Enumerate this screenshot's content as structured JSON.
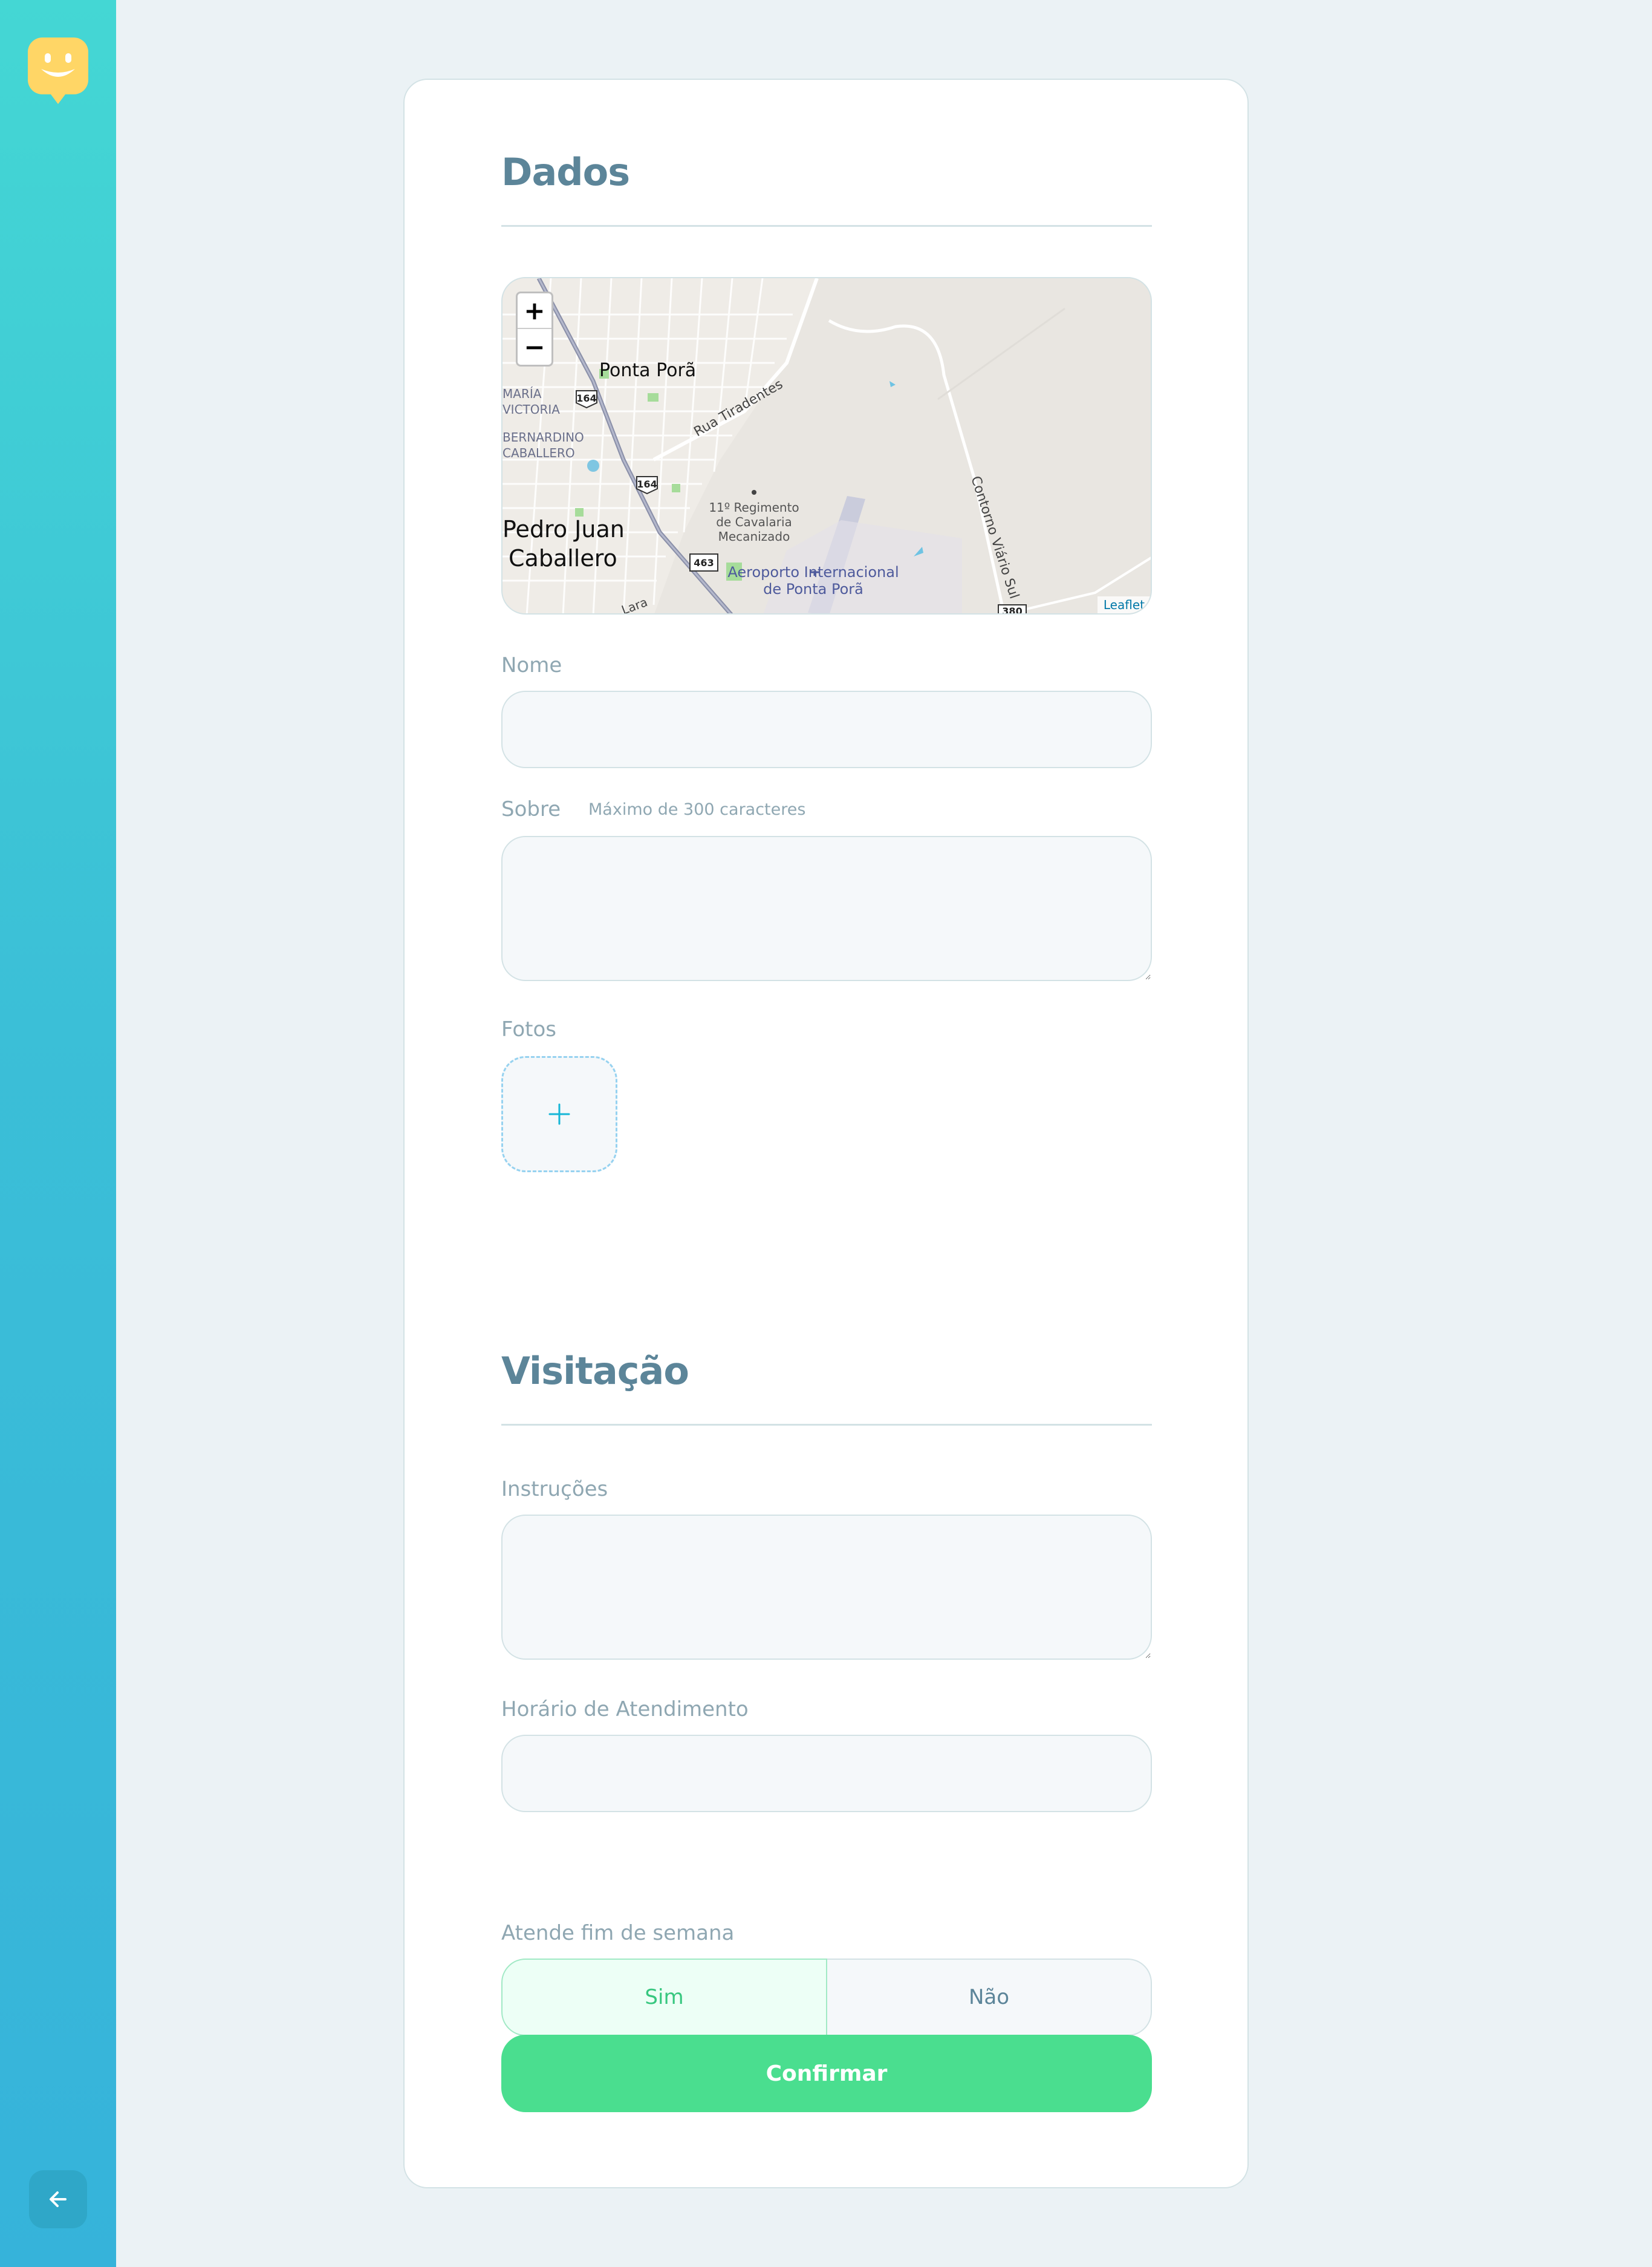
{
  "sidebar": {
    "logo_icon": "happy-face-marker-icon",
    "back_icon": "arrow-left-icon"
  },
  "sections": {
    "dados": {
      "title": "Dados"
    },
    "visitacao": {
      "title": "Visitação"
    }
  },
  "map": {
    "zoom_in": "+",
    "zoom_out": "−",
    "attribution": "Leaflet",
    "labels": {
      "city_main": "Ponta Porã",
      "city_other_1": "Pedro Juan",
      "city_other_2": "Caballero",
      "district_1a": "MARÍA",
      "district_1b": "VICTORIA",
      "district_2a": "BERNARDINO",
      "district_2b": "CABALLERO",
      "street_1": "Rua Tiradentes",
      "street_2": "Contorno Viário Sul",
      "street_3": "Lara",
      "poi_1a": "11º Regimento",
      "poi_1b": "de Cavalaria",
      "poi_1c": "Mecanizado",
      "airport_1": "Aeroporto Internacional",
      "airport_2": "de Ponta Porã",
      "route_164": "164",
      "route_463": "463",
      "route_380": "380"
    }
  },
  "fields": {
    "nome": {
      "label": "Nome",
      "value": ""
    },
    "sobre": {
      "label": "Sobre",
      "hint": "Máximo de 300 caracteres",
      "value": ""
    },
    "fotos": {
      "label": "Fotos"
    },
    "instrucoes": {
      "label": "Instruções",
      "value": ""
    },
    "horario": {
      "label": "Horário de Atendimento",
      "value": ""
    },
    "fim_de_semana": {
      "label": "Atende fim de semana",
      "yes": "Sim",
      "no": "Não",
      "selected": "Sim"
    }
  },
  "actions": {
    "confirm": "Confirmar"
  },
  "colors": {
    "sidebar_top": "#44d7d4",
    "sidebar_bottom": "#36b3da",
    "logo": "#ffd666",
    "title": "#5c8599",
    "label": "#8fa7b2",
    "confirm": "#4ade8f",
    "yes_text": "#37c77f"
  }
}
